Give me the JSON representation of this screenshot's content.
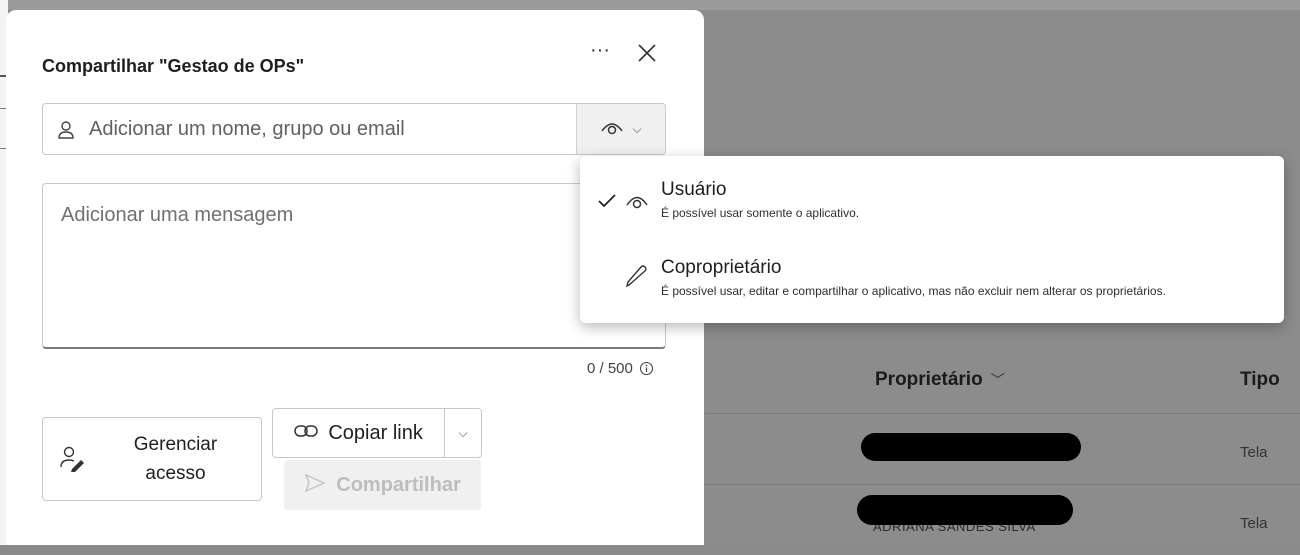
{
  "dialog": {
    "title": "Compartilhar \"Gestao de OPs\"",
    "more_icon": "ellipsis-icon",
    "close_icon": "close-icon"
  },
  "people_input": {
    "placeholder": "Adicionar um nome, grupo ou email",
    "icon": "person-icon",
    "permission_icon": "eye-icon"
  },
  "message": {
    "placeholder": "Adicionar uma mensagem",
    "counter": "0 / 500"
  },
  "buttons": {
    "manage_access": "Gerenciar acesso",
    "copy_link": "Copiar link",
    "share": "Compartilhar"
  },
  "permission_menu": {
    "items": [
      {
        "title": "Usuário",
        "description": "É possível usar somente o aplicativo.",
        "icon": "eye-icon",
        "selected": true
      },
      {
        "title": "Coproprietário",
        "description": "É possível usar, editar e compartilhar o aplicativo, mas não excluir nem alterar os proprietários.",
        "icon": "pencil-icon",
        "selected": false
      }
    ]
  },
  "background_table": {
    "columns": [
      "Proprietário",
      "Tipo"
    ],
    "rows": [
      {
        "type": "Tela"
      },
      {
        "type": "Tela"
      }
    ],
    "partial_owner_text": "ADRIANA SANDES SILVA"
  }
}
